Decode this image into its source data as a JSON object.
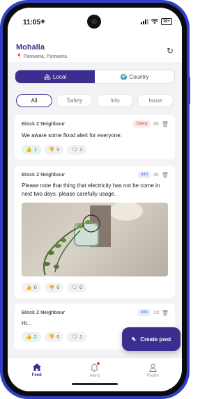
{
  "status": {
    "time": "11:05",
    "battery": "10+"
  },
  "header": {
    "title": "Mohalla",
    "location": "Panwaria, Panwaria"
  },
  "scope_tabs": [
    {
      "label": "Local",
      "icon": "🏘",
      "active": true
    },
    {
      "label": "Country",
      "icon": "🌍",
      "active": false
    }
  ],
  "filters": [
    {
      "label": "All",
      "active": true
    },
    {
      "label": "Safety",
      "active": false
    },
    {
      "label": "Info",
      "active": false
    },
    {
      "label": "Issue",
      "active": false
    }
  ],
  "posts": [
    {
      "author": "Block Z Neighbour",
      "tag": "Safety",
      "age": "8h",
      "text": "We aware some flood alert for everyone.",
      "likes": "1",
      "dislikes": "0",
      "comments": "1",
      "liked": true
    },
    {
      "author": "Block Z Neighbour",
      "tag": "Info",
      "age": "9h",
      "text": "Please note that thing that electricity has not be come in next two days. please carefully usage.",
      "likes": "0",
      "dislikes": "0",
      "comments": "0",
      "liked": false
    },
    {
      "author": "Block Z Neighbour",
      "tag": "Info",
      "age": "2d",
      "text": "Hi...",
      "likes": "2",
      "dislikes": "0",
      "comments": "1",
      "liked": true
    }
  ],
  "fab": {
    "label": "Create post"
  },
  "tabbar": [
    {
      "label": "Feed",
      "icon": "home-icon",
      "active": true
    },
    {
      "label": "Alerts",
      "icon": "bell-icon",
      "active": false
    },
    {
      "label": "Profile",
      "icon": "person-icon",
      "active": false
    }
  ],
  "colors": {
    "brand": "#3a2f8f",
    "frame": "#2f3fc6",
    "safety": "#d9534f",
    "info": "#3568d4",
    "liked": "#2e8b57"
  }
}
